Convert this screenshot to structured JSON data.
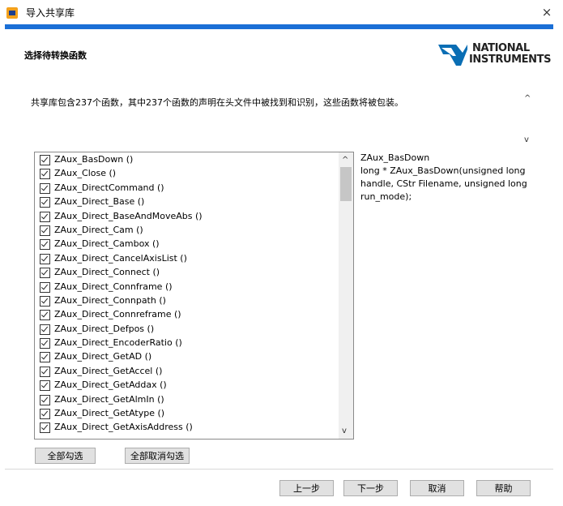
{
  "window": {
    "title": "导入共享库",
    "close_glyph": "×"
  },
  "header": {
    "section_title": "选择待转换函数",
    "logo_line1": "NATIONAL",
    "logo_line2": "INSTRUMENTS",
    "accent_color": "#1b6fd6"
  },
  "description": "共享库包含237个函数，其中237个函数的声明在头文件中被找到和识别，这些函数将被包装。",
  "functions": [
    {
      "label": "ZAux_BasDown ()",
      "checked": true
    },
    {
      "label": "ZAux_Close ()",
      "checked": true
    },
    {
      "label": "ZAux_DirectCommand ()",
      "checked": true
    },
    {
      "label": "ZAux_Direct_Base ()",
      "checked": true
    },
    {
      "label": "ZAux_Direct_BaseAndMoveAbs ()",
      "checked": true
    },
    {
      "label": "ZAux_Direct_Cam ()",
      "checked": true
    },
    {
      "label": "ZAux_Direct_Cambox ()",
      "checked": true
    },
    {
      "label": "ZAux_Direct_CancelAxisList ()",
      "checked": true
    },
    {
      "label": "ZAux_Direct_Connect ()",
      "checked": true
    },
    {
      "label": "ZAux_Direct_Connframe ()",
      "checked": true
    },
    {
      "label": "ZAux_Direct_Connpath ()",
      "checked": true
    },
    {
      "label": "ZAux_Direct_Connreframe ()",
      "checked": true
    },
    {
      "label": "ZAux_Direct_Defpos ()",
      "checked": true
    },
    {
      "label": "ZAux_Direct_EncoderRatio ()",
      "checked": true
    },
    {
      "label": "ZAux_Direct_GetAD ()",
      "checked": true
    },
    {
      "label": "ZAux_Direct_GetAccel ()",
      "checked": true
    },
    {
      "label": "ZAux_Direct_GetAddax ()",
      "checked": true
    },
    {
      "label": "ZAux_Direct_GetAlmIn ()",
      "checked": true
    },
    {
      "label": "ZAux_Direct_GetAtype ()",
      "checked": true
    },
    {
      "label": "ZAux_Direct_GetAxisAddress ()",
      "checked": true
    }
  ],
  "detail": {
    "name": "ZAux_BasDown",
    "signature": "long * ZAux_BasDown(unsigned long handle, CStr Filename, unsigned long run_mode);"
  },
  "buttons": {
    "select_all": "全部勾选",
    "deselect_all": "全部取消勾选",
    "prev": "上一步",
    "next": "下一步",
    "cancel": "取消",
    "help": "帮助"
  },
  "icons": {
    "scroll_up": "up-arrow-icon",
    "scroll_down": "down-arrow-icon",
    "app": "labview-icon",
    "logo": "ni-eagle-icon"
  }
}
